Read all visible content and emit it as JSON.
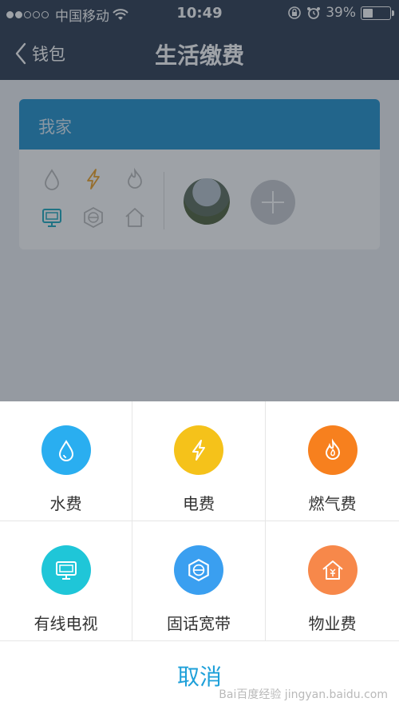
{
  "status_bar": {
    "carrier": "中国移动",
    "time": "10:49",
    "battery_percent": "39%",
    "battery_level": 0.39,
    "signal_dots_filled": 2,
    "signal_dots_total": 5
  },
  "nav": {
    "back_label": "钱包",
    "title": "生活缴费"
  },
  "card": {
    "header": "我家",
    "mini_icons": [
      "water-icon",
      "lightning-icon",
      "flame-icon",
      "tv-icon",
      "broadband-icon",
      "house-icon"
    ]
  },
  "sheet": {
    "options": [
      {
        "label": "水费",
        "icon": "water-drop-icon",
        "color": "#2aaef0"
      },
      {
        "label": "电费",
        "icon": "lightning-icon",
        "color": "#f5c21a"
      },
      {
        "label": "燃气费",
        "icon": "flame-icon",
        "color": "#f7801e"
      },
      {
        "label": "有线电视",
        "icon": "tv-icon",
        "color": "#1fc6d8"
      },
      {
        "label": "固话宽带",
        "icon": "broadband-icon",
        "color": "#3a9ff0"
      },
      {
        "label": "物业费",
        "icon": "house-yen-icon",
        "color": "#f7884a"
      }
    ],
    "cancel_label": "取消"
  },
  "watermark": "Bai百度经验 jingyan.baidu.com"
}
